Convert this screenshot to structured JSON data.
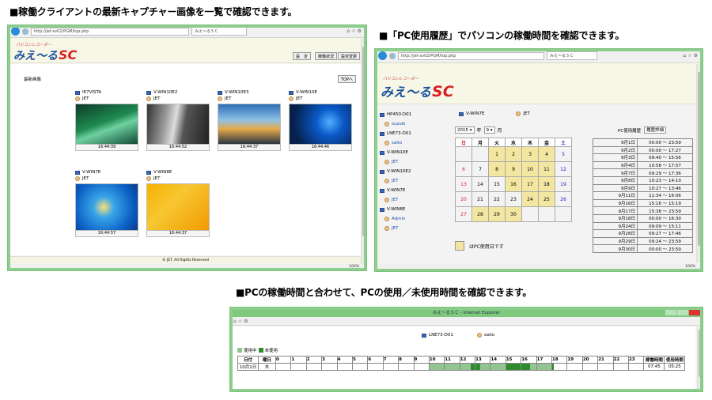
{
  "headings": {
    "h1": "■稼働クライアントの最新キャプチャー画像を一覧で確認できます。",
    "h2": "■「PC使用履歴」でパソコンの稼働時間を確認できます。",
    "h3": "■PCの稼働時間と合わせて、PCの使用／未使用時間を確認できます。"
  },
  "win1": {
    "address": "http://jet-sv02/PGM/top.php",
    "tab": "みえ～るＳＣ",
    "logo_small": "パソコンレコーダー",
    "logo_main": "みえ～る",
    "logo_sc": "SC",
    "btn_settings": "設　定",
    "btn_status": "稼働状況",
    "btn_config": "設定変更",
    "section_title": "最新画像",
    "top_button": "TOPへ",
    "captures": [
      {
        "pc": "IE7VISTA",
        "user": "JET",
        "time": "16:44:39"
      },
      {
        "pc": "V-WIN10E2",
        "user": "JET",
        "time": "16:44:52"
      },
      {
        "pc": "V-WIN10E3",
        "user": "JET",
        "time": "16:44:37"
      },
      {
        "pc": "V-WIN10E",
        "user": "JET",
        "time": "16:44:46"
      },
      {
        "pc": "V-WIN7E",
        "user": "JET",
        "time": "16:44:57"
      },
      {
        "pc": "V-WIN8E",
        "user": "JET",
        "time": "16:44:37"
      }
    ],
    "footer": "© JET. All Rights Reserved",
    "zoom": "100%"
  },
  "win2": {
    "address": "http://jet-sv02/PGM/top.php",
    "tab": "みえ～るＳＣ",
    "logo_small": "パソコンレコーダー",
    "logo_main": "みえ～る",
    "logo_sc": "SC",
    "machines": [
      {
        "pc": "HP450-D01",
        "users": [
          "suzuki"
        ]
      },
      {
        "pc": "LNE73-D01",
        "users": [
          "saito"
        ]
      },
      {
        "pc": "V-WIN10E",
        "users": [
          "JET"
        ]
      },
      {
        "pc": "V-WIN10E2",
        "users": [
          "JET"
        ]
      },
      {
        "pc": "V-WIN7E",
        "users": [
          "JET"
        ]
      },
      {
        "pc": "V-WIN8E",
        "users": [
          "Admin",
          "JET"
        ]
      }
    ],
    "selected_pc": "V-WIN7E",
    "selected_user": "JET",
    "year": "2015",
    "year_label": "年",
    "month": "9",
    "month_label": "月",
    "history_label": "PC使用履歴",
    "history_detail_button": "履歴詳細",
    "weekdays": [
      "日",
      "月",
      "火",
      "水",
      "木",
      "金",
      "土"
    ],
    "calendar": [
      [
        "",
        "",
        "1",
        "2",
        "3",
        "4",
        "5"
      ],
      [
        "6",
        "7",
        "8",
        "9",
        "10",
        "11",
        "12"
      ],
      [
        "13",
        "14",
        "15",
        "16",
        "17",
        "18",
        "19"
      ],
      [
        "20",
        "21",
        "22",
        "23",
        "24",
        "25",
        "26"
      ],
      [
        "27",
        "28",
        "29",
        "30",
        "",
        "",
        ""
      ]
    ],
    "used_days": [
      "1",
      "2",
      "3",
      "4",
      "8",
      "9",
      "10",
      "11",
      "16",
      "17",
      "18",
      "24",
      "25",
      "28",
      "29",
      "30"
    ],
    "legend": "はPC使用日です",
    "history": [
      {
        "date": "9月1日",
        "time": "00:00 ～ 23:59"
      },
      {
        "date": "9月2日",
        "time": "00:00 ～ 17:27"
      },
      {
        "date": "9月3日",
        "time": "09:40 ～ 15:56"
      },
      {
        "date": "9月4日",
        "time": "10:58 ～ 17:57"
      },
      {
        "date": "9月7日",
        "time": "09:29 ～ 17:36"
      },
      {
        "date": "9月8日",
        "time": "10:23 ～ 14:10"
      },
      {
        "date": "9月9日",
        "time": "10:27 ～ 13:46"
      },
      {
        "date": "9月11日",
        "time": "11:34 ～ 16:06"
      },
      {
        "date": "9月16日",
        "time": "15:16 ～ 15:19"
      },
      {
        "date": "9月17日",
        "time": "15:38 ～ 23:59"
      },
      {
        "date": "9月18日",
        "time": "00:00 ～ 16:30"
      },
      {
        "date": "9月24日",
        "time": "09:09 ～ 15:11"
      },
      {
        "date": "9月28日",
        "time": "09:27 ～ 17:46"
      },
      {
        "date": "9月29日",
        "time": "09:24 ～ 23:59"
      },
      {
        "date": "9月30日",
        "time": "00:00 ～ 23:59"
      }
    ],
    "zoom": "100%"
  },
  "win3": {
    "title": "みえ～るＳＣ - Internet Explorer",
    "pc": "LNE73-D01",
    "user": "saito",
    "legend_using": "使用中",
    "legend_unused": "未使用",
    "col_date": "日付",
    "col_weekday": "曜日",
    "hours": [
      "0",
      "1",
      "2",
      "3",
      "4",
      "5",
      "6",
      "7",
      "8",
      "9",
      "10",
      "11",
      "12",
      "13",
      "14",
      "15",
      "16",
      "17",
      "18",
      "19",
      "20",
      "21",
      "22",
      "23"
    ],
    "col_active": "稼働時間",
    "col_usage": "使用時間",
    "row_date": "10月1日",
    "row_weekday": "木",
    "row_active": "07:45",
    "row_usage": "05:25",
    "color_using": "#93c593",
    "color_unused": "#2e8b2e"
  }
}
